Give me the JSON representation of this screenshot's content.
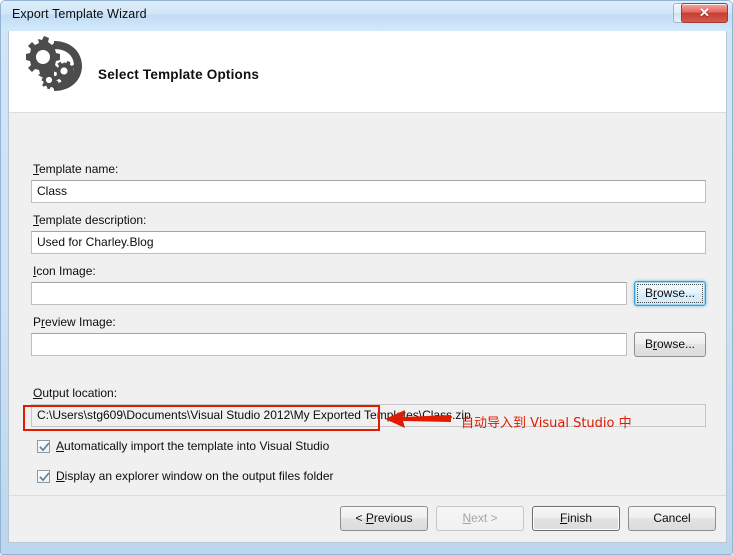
{
  "window": {
    "title": "Export Template Wizard",
    "help_glyph": "?",
    "close_glyph": "✕"
  },
  "banner": {
    "icon": "gears-arrow-icon",
    "title": "Select Template Options"
  },
  "form": {
    "template_name": {
      "label_pre": "",
      "label_accel": "T",
      "label_post": "emplate name:",
      "value": "Class"
    },
    "template_description": {
      "label_pre": "",
      "label_accel": "T",
      "label_post": "emplate description:",
      "value": "Used for Charley.Blog"
    },
    "icon_image": {
      "label_pre": "",
      "label_accel": "I",
      "label_post": "con Image:",
      "value": "",
      "browse_label_pre": "B",
      "browse_label_accel": "r",
      "browse_label_post": "owse..."
    },
    "preview_image": {
      "label_pre": "P",
      "label_accel": "r",
      "label_post": "eview Image:",
      "value": "",
      "browse_label_pre": "B",
      "browse_label_accel": "r",
      "browse_label_post": "owse..."
    },
    "output_location": {
      "label_pre": "",
      "label_accel": "O",
      "label_post": "utput location:",
      "value": "C:\\Users\\stg609\\Documents\\Visual Studio 2012\\My Exported Templates\\Class.zip"
    }
  },
  "checkboxes": [
    {
      "name": "auto-import",
      "checked": true,
      "label_pre": "",
      "label_accel": "A",
      "label_post": "utomatically import the template into Visual Studio"
    },
    {
      "name": "display-explorer",
      "checked": true,
      "label_pre": "",
      "label_accel": "D",
      "label_post": "isplay an explorer window on the output files folder"
    }
  ],
  "footer": {
    "previous": {
      "pre": "< ",
      "accel": "P",
      "post": "revious"
    },
    "next": {
      "pre": "",
      "accel": "N",
      "post": "ext >",
      "disabled": true
    },
    "finish": {
      "pre": "",
      "accel": "F",
      "post": "inish",
      "is_default": true
    },
    "cancel": {
      "pre": "Cancel",
      "accel": "",
      "post": ""
    }
  },
  "annotation": {
    "text": "自动导入到 Visual Studio 中",
    "color": "#e01b00",
    "arrow": "left-arrow-icon",
    "highlight": "red-rectangle-highlight"
  }
}
